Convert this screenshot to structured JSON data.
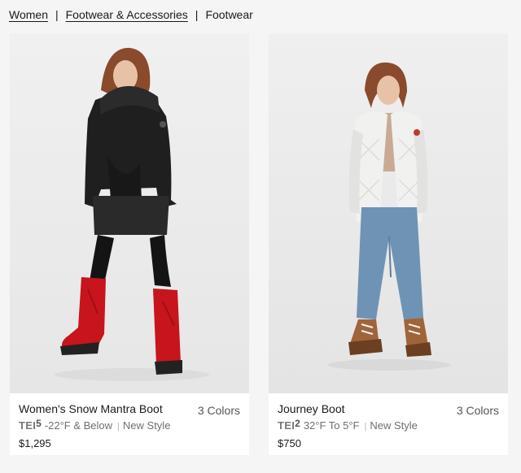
{
  "breadcrumb": {
    "items": [
      "Women",
      "Footwear & Accessories"
    ],
    "current": "Footwear",
    "separator": "|"
  },
  "products": [
    {
      "name": "Women's Snow Mantra Boot",
      "colors_label": "3 Colors",
      "tei_prefix": "TEI",
      "tei_level": "5",
      "temp_range": "-22°F & Below",
      "badge": "New Style",
      "price": "$1,295",
      "image_icon": "model-black-parka-red-boots"
    },
    {
      "name": "Journey Boot",
      "colors_label": "3 Colors",
      "tei_prefix": "TEI",
      "tei_level": "2",
      "temp_range": "32°F To 5°F",
      "badge": "New Style",
      "price": "$750",
      "image_icon": "model-quilted-cardigan-brown-boots"
    }
  ],
  "colors": {
    "background": "#f4f5f4",
    "card": "#ffffff",
    "text": "#1a1a1a",
    "muted": "#7a7a7a",
    "boot_red": "#c8141c",
    "boot_brown": "#a0643a"
  }
}
